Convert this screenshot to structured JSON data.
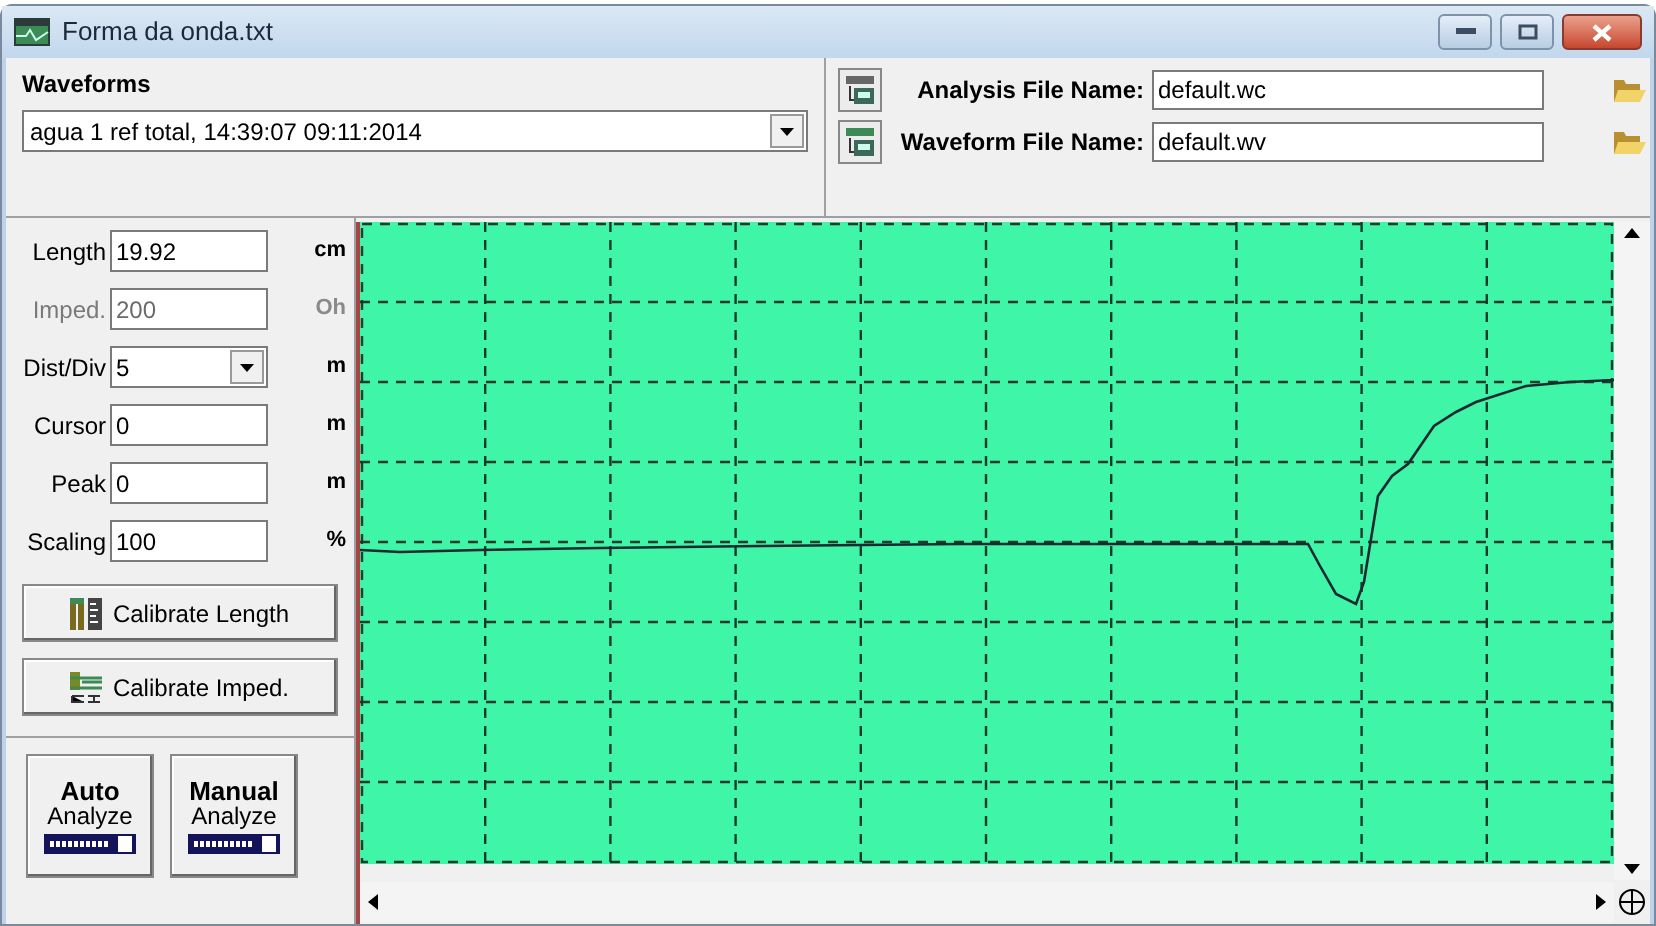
{
  "window": {
    "title": "Forma da onda.txt"
  },
  "waveforms": {
    "label": "Waveforms",
    "value": "agua 1 ref total, 14:39:07 09:11:2014"
  },
  "files": [
    {
      "label": "Analysis File Name:",
      "value": "default.wc"
    },
    {
      "label": "Waveform File Name:",
      "value": "default.wv"
    }
  ],
  "params": [
    {
      "kind": "field",
      "label": "Length",
      "value": "19.92",
      "unit": "cm",
      "disabled": false
    },
    {
      "kind": "field",
      "label": "Imped.",
      "value": "200",
      "unit": "Oh",
      "disabled": true
    },
    {
      "kind": "dropdown",
      "label": "Dist/Div",
      "value": "5",
      "unit": "m",
      "disabled": false
    },
    {
      "kind": "field",
      "label": "Cursor",
      "value": "0",
      "unit": "m",
      "disabled": false
    },
    {
      "kind": "field",
      "label": "Peak",
      "value": "0",
      "unit": "m",
      "disabled": false
    },
    {
      "kind": "field",
      "label": "Scaling",
      "value": "100",
      "unit": "%",
      "disabled": false
    }
  ],
  "calibrate_buttons": [
    {
      "kind": "length",
      "label": "Calibrate Length"
    },
    {
      "kind": "imped",
      "label": "Calibrate Imped."
    }
  ],
  "analyze_buttons": [
    {
      "title": "Auto",
      "subtitle": "Analyze"
    },
    {
      "title": "Manual",
      "subtitle": "Analyze"
    }
  ]
}
